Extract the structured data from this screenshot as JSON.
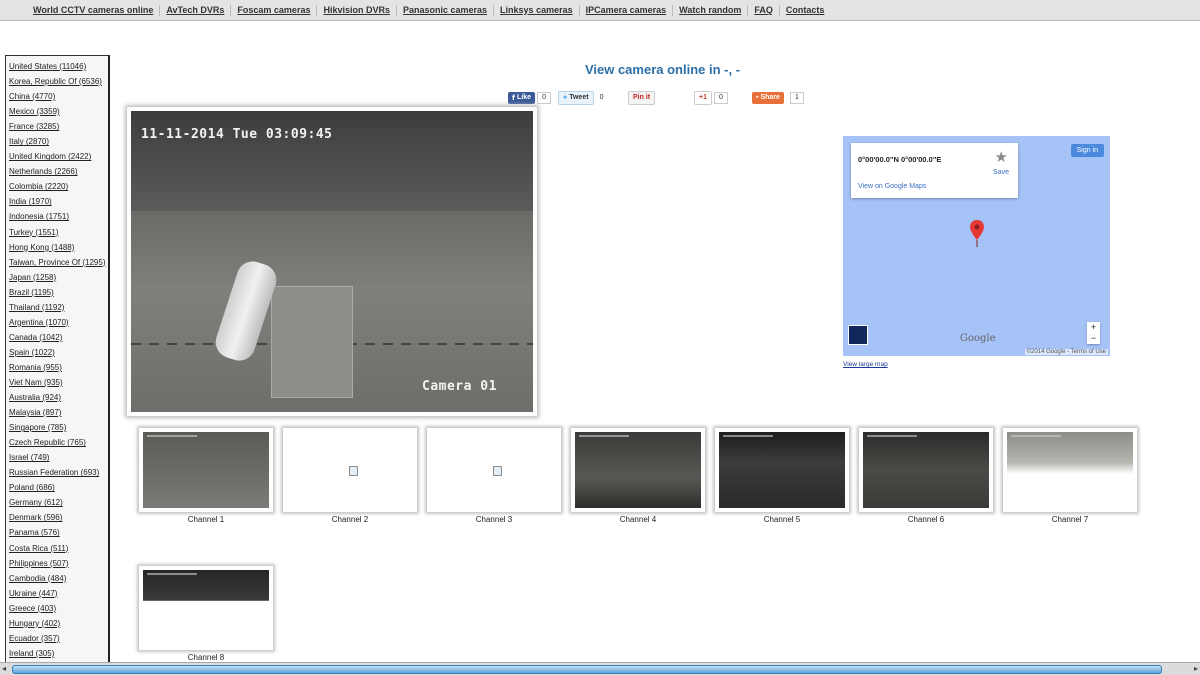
{
  "nav": [
    "World CCTV cameras online",
    "AvTech DVRs",
    "Foscam cameras",
    "Hikvision DVRs",
    "Panasonic cameras",
    "Linksys cameras",
    "IPCamera cameras",
    "Watch random",
    "FAQ",
    "Contacts"
  ],
  "countries": [
    "United States (11046)",
    "Korea, Republic Of (6536)",
    "China (4770)",
    "Mexico (3359)",
    "France (3285)",
    "Italy (2870)",
    "United Kingdom (2422)",
    "Netherlands (2266)",
    "Colombia (2220)",
    "India (1970)",
    "Indonesia (1751)",
    "Turkey (1551)",
    "Hong Kong (1488)",
    "Taiwan, Province Of (1295)",
    "Japan (1258)",
    "Brazil (1195)",
    "Thailand (1192)",
    "Argentina (1070)",
    "Canada (1042)",
    "Spain (1022)",
    "Romania (955)",
    "Viet Nam (935)",
    "Australia (924)",
    "Malaysia (897)",
    "Singapore (785)",
    "Czech Republic (765)",
    "Israel (749)",
    "Russian Federation (693)",
    "Poland (686)",
    "Germany (612)",
    "Denmark (596)",
    "Panama (576)",
    "Costa Rica (511)",
    "Philippines (507)",
    "Cambodia (484)",
    "Ukraine (447)",
    "Greece (403)",
    "Hungary (402)",
    "Ecuador (357)",
    "Ireland (305)"
  ],
  "title": "View camera online in -, -",
  "share": {
    "fb_label": "Like",
    "fb_count": "0",
    "tw_label": "Tweet",
    "tw_count": "0",
    "pin_label": "Pin it",
    "gplus_label": "+1",
    "gplus_count": "0",
    "sh_label": "Share",
    "sh_count": "1"
  },
  "main_camera": {
    "timestamp": "11-11-2014 Tue 03:09:45",
    "label": "Camera 01"
  },
  "map": {
    "coords": "0°00'00.0\"N 0°00'00.0\"E",
    "view_link": "View on Google Maps",
    "save": "Save",
    "signin": "Sign in",
    "logo": "Google",
    "attribution": "©2014 Google - Terms of Use",
    "large_map": "View large map",
    "zoom_in": "+",
    "zoom_out": "−"
  },
  "channels": [
    {
      "label": "Channel 1",
      "state": "feed"
    },
    {
      "label": "Channel 2",
      "state": "broken"
    },
    {
      "label": "Channel 3",
      "state": "broken"
    },
    {
      "label": "Channel 4",
      "state": "feed"
    },
    {
      "label": "Channel 5",
      "state": "feed"
    },
    {
      "label": "Channel 6",
      "state": "feed"
    },
    {
      "label": "Channel 7",
      "state": "feed"
    },
    {
      "label": "Channel 8",
      "state": "feed"
    }
  ],
  "colors": {
    "title": "#2b6fa6",
    "facebook": "#3b5998",
    "twitter": "#55acee",
    "pinterest": "#cb2027",
    "share": "#e8703a",
    "map_water": "#a6c3f7"
  }
}
